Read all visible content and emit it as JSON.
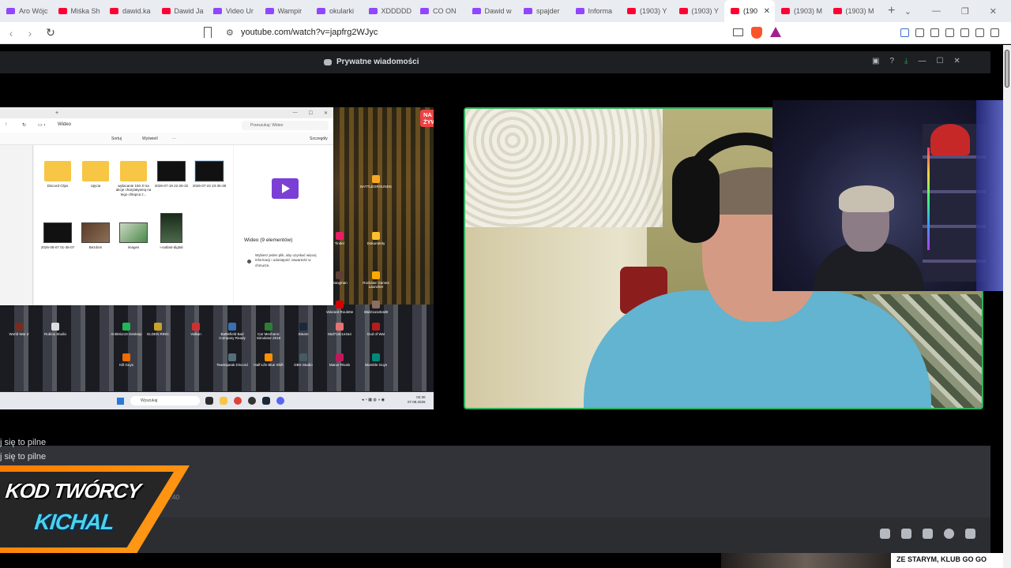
{
  "browser": {
    "tabs": [
      {
        "label": "Aro Wójc",
        "kind": "tw"
      },
      {
        "label": "Miśka Sh",
        "kind": "yt"
      },
      {
        "label": "dawid.ka",
        "kind": "yt"
      },
      {
        "label": "Dawid Ja",
        "kind": "yt"
      },
      {
        "label": "Video Ur",
        "kind": "tw"
      },
      {
        "label": "Wampir",
        "kind": "tw"
      },
      {
        "label": "okularki",
        "kind": "tw"
      },
      {
        "label": "XDDDDD",
        "kind": "tw"
      },
      {
        "label": "CO ON",
        "kind": "tw"
      },
      {
        "label": "Dawid w",
        "kind": "tw"
      },
      {
        "label": "spajder",
        "kind": "tw"
      },
      {
        "label": "Informa",
        "kind": "tw"
      },
      {
        "label": "(1903) Y",
        "kind": "yt"
      },
      {
        "label": "(1903) Y",
        "kind": "yt"
      },
      {
        "label": "(190",
        "kind": "yt",
        "active": true
      },
      {
        "label": "(1903) M",
        "kind": "yt"
      },
      {
        "label": "(1903) M",
        "kind": "yt"
      }
    ],
    "new_tab": "+",
    "url": "youtube.com/watch?v=japfrg2WJyc"
  },
  "discord": {
    "title": "Prywatne wiadomości",
    "live_badge": "NA ŻYWO",
    "explorer": {
      "crumb": "Wideo",
      "search_placeholder": "Przeszukaj: Wideo",
      "sort": "Sortuj",
      "view": "Wyświetl",
      "more": "···",
      "details": "Szczegóły",
      "items": [
        {
          "label": "Discord Clips",
          "type": "folder"
        },
        {
          "label": "Ujęcia",
          "type": "folder"
        },
        {
          "label": "wplacanie 150 zł na akcje charytatywną na tego chłopca z...",
          "type": "folder"
        },
        {
          "label": "2026-07-19 22-26-32",
          "type": "video"
        },
        {
          "label": "2026-07-22 23-35-38",
          "type": "video"
        },
        {
          "label": "2026-08-07 01-36-07",
          "type": "video"
        },
        {
          "label": "Bezdom",
          "type": "img1"
        },
        {
          "label": "images",
          "type": "img2"
        },
        {
          "label": "i-outlast-digital",
          "type": "img3"
        }
      ],
      "preview_title": "Wideo (9 elementów)",
      "preview_hint": "Wybierz jeden plik, aby uzyskać więcej informacji i udostępnić zawartość w chmurze."
    },
    "desktop_icons": [
      "World War Z",
      "Roblox Studio",
      "AntiMicroX Desktop",
      "ELDEN RING",
      "Vulkan",
      "Battlefield Bad Company Ready",
      "Car Mechanic Simulator 2018",
      "Steam",
      "65d71dc1e2a4",
      "God of War",
      "Kill Guys",
      "Teamspeak Discord",
      "Half-Life Blue Shift",
      "DBS Studio",
      "Manor Rivals",
      "Stumble Guys",
      "Hangman",
      "BATTLEGROUNDS",
      "Tinder",
      "Dokumenty",
      "Rockstar Games Launcher",
      "65d21a1e54d8",
      "Valorant Roulette"
    ],
    "taskbar": {
      "search": "Wyszukaj",
      "time": "02:30",
      "date": "07.08.2026"
    },
    "chat": {
      "lines": [
        "j się to pilne",
        "j się to pilne",
        "?????????????"
      ],
      "time": "01:40"
    }
  },
  "overlay": {
    "creator_line1": "KOD TWÓRCY",
    "creator_line2": "KICHAL"
  },
  "teaser": {
    "text": "ZE STARYM, KLUB GO GO"
  }
}
